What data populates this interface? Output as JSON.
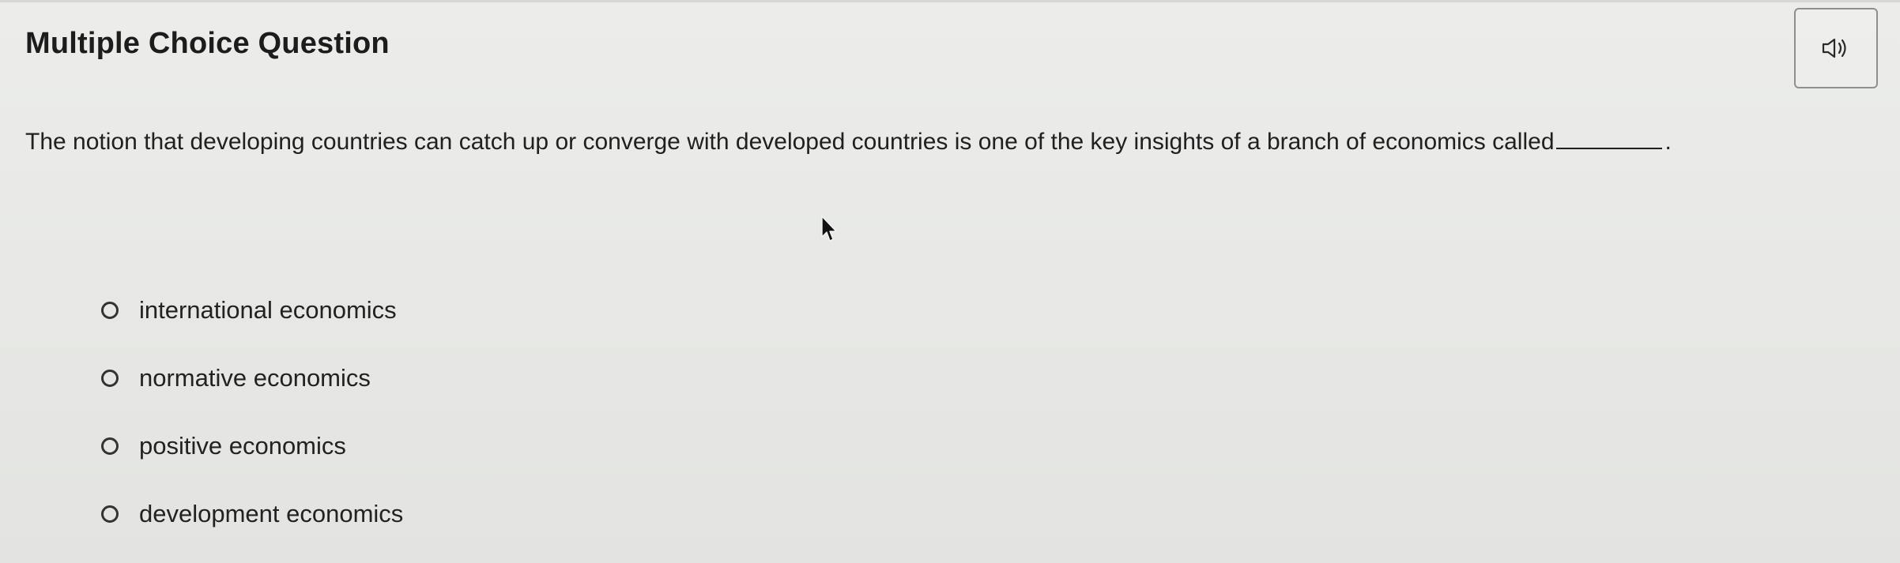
{
  "header": {
    "title": "Multiple Choice Question",
    "audio_icon": "speaker-icon"
  },
  "question": {
    "text": "The notion that developing countries can catch up or converge with developed countries is one of the key insights of a branch of economics called",
    "suffix": "."
  },
  "choices": [
    {
      "label": "international economics"
    },
    {
      "label": "normative economics"
    },
    {
      "label": "positive economics"
    },
    {
      "label": "development economics"
    }
  ],
  "colors": {
    "background": "#e8e9e6",
    "text": "#202020",
    "button_border": "#8f8f8f"
  }
}
